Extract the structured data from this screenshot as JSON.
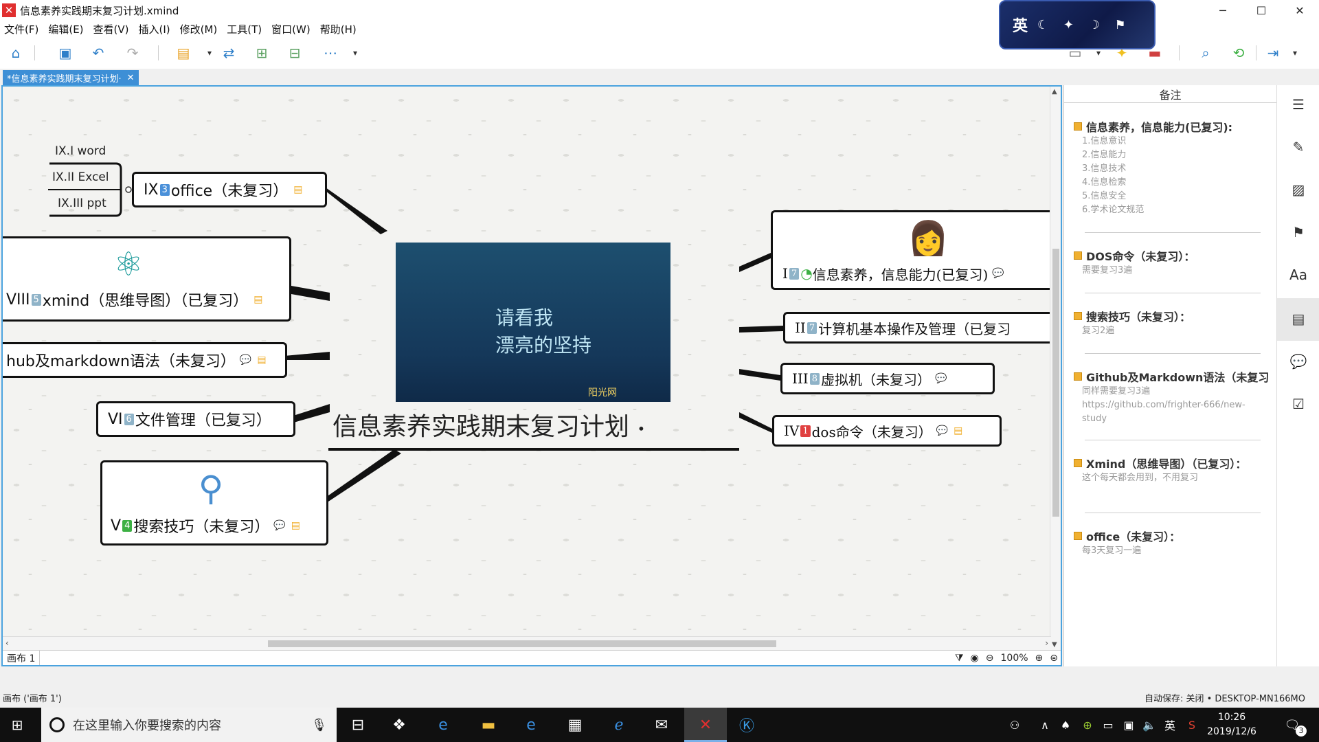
{
  "window": {
    "title": "信息素养实践期末复习计划.xmind",
    "controls": {
      "minimize": "─",
      "maximize": "☐",
      "close": "✕"
    },
    "ime": {
      "char": "英",
      "icons": "☾ ✦ ☽ ⚑"
    }
  },
  "menu": [
    "文件(F)",
    "编辑(E)",
    "查看(V)",
    "插入(I)",
    "修改(M)",
    "工具(T)",
    "窗口(W)",
    "帮助(H)"
  ],
  "tab": {
    "label": "*信息素养实践期末复习计划·",
    "close": "✕"
  },
  "map": {
    "central": {
      "title": "信息素养实践期末复习计划",
      "image_line1": "请看我",
      "image_line2": "漂亮的坚持",
      "image_logo": "阳光网"
    },
    "nodes": {
      "office": {
        "prefix": "IX",
        "num": "3",
        "label": "office（未复习）"
      },
      "xmind": {
        "prefix": "VIII",
        "num": "5",
        "label": "xmind（思维导图）（已复习）"
      },
      "github": {
        "label": "hub及markdown语法（未复习）"
      },
      "files": {
        "prefix": "VI",
        "num": "6",
        "label": "文件管理（已复习）"
      },
      "search": {
        "prefix": "V",
        "num": "4",
        "label": "搜索技巧（未复习）"
      },
      "info": {
        "prefix": "I",
        "num": "7",
        "label": "信息素养，信息能力(已复习)"
      },
      "computer": {
        "prefix": "II",
        "num": "7",
        "label": "计算机基本操作及管理（已复习"
      },
      "vm": {
        "prefix": "III",
        "num": "8",
        "label": "虚拟机（未复习）"
      },
      "dos": {
        "prefix": "IV",
        "num": "1",
        "label": "dos命令（未复习）"
      }
    },
    "subtopics": [
      "IX.I word",
      "IX.II Excel",
      "IX.III ppt"
    ]
  },
  "canvas_status": {
    "sheet": "画布 1",
    "zoom": "100%"
  },
  "notes_panel": {
    "header": "备注",
    "sections": [
      {
        "title": "信息素养，信息能力(已复习):",
        "lines": [
          "1.信息意识",
          "2.信息能力",
          "3.信息技术",
          "4.信息检索",
          "5.信息安全",
          "6.学术论文规范"
        ]
      },
      {
        "title": "DOS命令（未复习）：",
        "lines": [
          "需要复习3遍"
        ]
      },
      {
        "title": "搜索技巧（未复习）：",
        "lines": [
          "复习2遍"
        ]
      },
      {
        "title": "Github及Markdown语法（未复习",
        "lines": [
          "同样需要复习3遍",
          "https://github.com/frighter-666/new-",
          "study"
        ]
      },
      {
        "title": "Xmind（思维导图）（已复习）：",
        "lines": [
          "这个每天都会用到，不用复习"
        ]
      },
      {
        "title": "office（未复习）：",
        "lines": [
          "每3天复习一遍"
        ]
      }
    ]
  },
  "statusbar": {
    "left": "画布 ('画布 1')",
    "right": "自动保存: 关闭   • DESKTOP-MN166MO"
  },
  "taskbar": {
    "search_placeholder": "在这里输入你要搜索的内容",
    "time": "10:26",
    "date": "2019/12/6",
    "ime": "英",
    "notification_count": "3"
  },
  "colors": {
    "accent": "#3d8fd6",
    "canvas_bg": "#f3f3f1",
    "app_red": "#e02f2f"
  }
}
